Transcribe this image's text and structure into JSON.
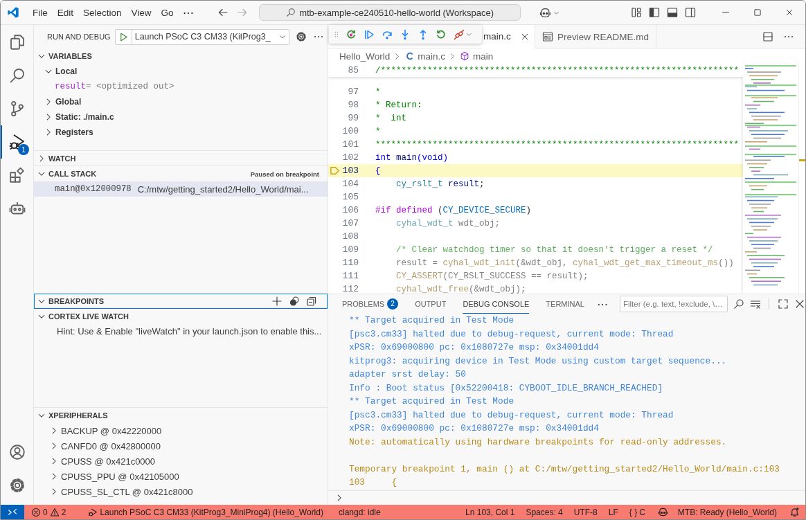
{
  "title_bar": {
    "menu": [
      {
        "label": "File"
      },
      {
        "label": "Edit"
      },
      {
        "label": "Selection"
      },
      {
        "label": "View"
      },
      {
        "label": "Go"
      }
    ],
    "overflow": "···",
    "command_center": "mtb-example-ce240510-hello-world (Workspace)"
  },
  "activity_bar": {
    "items": [
      {
        "kind": "explorer",
        "selected": false
      },
      {
        "kind": "search",
        "selected": false
      },
      {
        "kind": "source-control",
        "selected": false
      },
      {
        "kind": "run-debug",
        "selected": true,
        "badge": "1"
      },
      {
        "kind": "extensions",
        "selected": false
      },
      {
        "kind": "robot",
        "selected": false
      }
    ],
    "bottom": [
      {
        "kind": "account"
      },
      {
        "kind": "settings"
      }
    ]
  },
  "sidebar": {
    "title": "RUN AND DEBUG",
    "launch_config": "Launch PSoC C3 CM33 (KitProg3_",
    "sections": [
      {
        "kind": "variables",
        "title": "VARIABLES",
        "expanded": true,
        "items": [
          {
            "label": "Local",
            "expanded": true,
            "children": [
              {
                "name": "result",
                "value": "= <optimized out>"
              }
            ]
          },
          {
            "label": "Global",
            "expanded": false
          },
          {
            "label": "Static: ./main.c",
            "expanded": false
          },
          {
            "label": "Registers",
            "expanded": false
          }
        ]
      },
      {
        "kind": "watch",
        "title": "WATCH",
        "expanded": false
      },
      {
        "kind": "call-stack",
        "title": "CALL STACK",
        "expanded": true,
        "status": "Paused on breakpoint",
        "frames": [
          {
            "function": "main@0x12000978",
            "location": "C:/mtw/getting_started2/Hello_World/mai...",
            "selected": true
          }
        ]
      },
      {
        "kind": "breakpoints",
        "title": "BREAKPOINTS",
        "expanded": true,
        "focused": true
      },
      {
        "kind": "hint",
        "title": "CORTEX LIVE WATCH",
        "expanded": true,
        "hint": "Hint: Use & Enable \"liveWatch\" in your launch.json to enable this..."
      },
      {
        "kind": "peripherals",
        "title": "XPERIPHERALS",
        "expanded": true,
        "items": [
          {
            "label": "BACKUP @ 0x42220000",
            "expanded": false
          },
          {
            "label": "CANFD0 @ 0x42800000",
            "expanded": false
          },
          {
            "label": "CPUSS @ 0x421c0000",
            "expanded": false
          },
          {
            "label": "CPUSS_PPU @ 0x42105000",
            "expanded": false
          },
          {
            "label": "CPUSS_SL_CTL @ 0x421c8000",
            "expanded": false
          }
        ]
      }
    ]
  },
  "editor": {
    "tabs": [
      {
        "label": "main.c",
        "kind": "c",
        "selected": true
      },
      {
        "label": "Preview README.md",
        "kind": "preview",
        "selected": false
      }
    ],
    "breadcrumbs": [
      {
        "kind": "folder",
        "label": "Hello_World"
      },
      {
        "kind": "c-file",
        "label": "main.c"
      },
      {
        "kind": "symbol",
        "label": "main"
      }
    ],
    "sticky": {
      "number": "85",
      "segments": [
        {
          "kind": "comment",
          "text": "/*********************************************************************"
        }
      ]
    },
    "lines": [
      {
        "number": "97",
        "current": false,
        "segments": [
          {
            "kind": "comment",
            "text": "*"
          }
        ]
      },
      {
        "number": "98",
        "current": false,
        "segments": [
          {
            "kind": "comment",
            "text": "* Return:"
          }
        ]
      },
      {
        "number": "99",
        "current": false,
        "segments": [
          {
            "kind": "comment",
            "text": "*  int"
          }
        ]
      },
      {
        "number": "100",
        "current": false,
        "segments": [
          {
            "kind": "comment",
            "text": "*"
          }
        ]
      },
      {
        "number": "101",
        "current": false,
        "segments": [
          {
            "kind": "comment",
            "text": "**********************************************************************"
          }
        ]
      },
      {
        "number": "102",
        "current": false,
        "segments": [
          {
            "kind": "keyword",
            "text": "int"
          },
          {
            "kind": "func",
            "text": " main"
          },
          {
            "kind": "keyword",
            "text": "(void)"
          }
        ]
      },
      {
        "number": "103",
        "current": true,
        "segments": [
          {
            "kind": "keyword",
            "text": "{"
          }
        ]
      },
      {
        "number": "104",
        "current": false,
        "segments": [
          {
            "kind": "type",
            "text": "    cy_rslt_t"
          },
          {
            "kind": "variable",
            "text": " result"
          },
          {
            "kind": "plain",
            "text": ";"
          }
        ]
      },
      {
        "number": "105",
        "current": false
      },
      {
        "number": "106",
        "current": false,
        "segments": [
          {
            "kind": "preproc",
            "text": "#if defined"
          },
          {
            "kind": "plain",
            "text": " ("
          },
          {
            "kind": "macro",
            "text": "CY_DEVICE_SECURE"
          },
          {
            "kind": "plain",
            "text": ")"
          }
        ]
      },
      {
        "number": "107",
        "current": false,
        "segments": [
          {
            "kind": "dimtype",
            "text": "    cyhal_wdt_t"
          },
          {
            "kind": "dim",
            "text": " wdt_obj;"
          }
        ]
      },
      {
        "number": "108",
        "current": false
      },
      {
        "number": "109",
        "current": false,
        "segments": [
          {
            "kind": "dimcomment",
            "text": "    /* Clear watchdog timer so that it doesn't trigger a reset */"
          }
        ]
      },
      {
        "number": "110",
        "current": false,
        "segments": [
          {
            "kind": "dim",
            "text": "    result = "
          },
          {
            "kind": "dimfunc",
            "text": "cyhal_wdt_init"
          },
          {
            "kind": "dim",
            "text": "(&wdt_obj, "
          },
          {
            "kind": "dimfunc",
            "text": "cyhal_wdt_get_max_timeout_ms"
          },
          {
            "kind": "dim",
            "text": "())"
          }
        ]
      },
      {
        "number": "111",
        "current": false,
        "segments": [
          {
            "kind": "dimfunc",
            "text": "    CY_ASSERT"
          },
          {
            "kind": "dim",
            "text": "(CY_RSLT_SUCCESS == result);"
          }
        ]
      },
      {
        "number": "112",
        "current": false,
        "segments": [
          {
            "kind": "dimfunc",
            "text": "    cyhal_wdt_free"
          },
          {
            "kind": "dim",
            "text": "(&wdt_obj);"
          }
        ]
      }
    ]
  },
  "panel": {
    "tabs": [
      {
        "label": "PROBLEMS",
        "badge": "2",
        "selected": false
      },
      {
        "label": "OUTPUT",
        "selected": false
      },
      {
        "label": "DEBUG CONSOLE",
        "selected": true
      },
      {
        "label": "TERMINAL",
        "selected": false
      }
    ],
    "overflow": "···",
    "filter_placeholder": "Filter (e.g. text, !exclude, \\…",
    "console": [
      {
        "kind": "info",
        "text": "** Target acquired in Test Mode"
      },
      {
        "kind": "info",
        "text": "[psc3.cm33] halted due to debug-request, current mode: Thread"
      },
      {
        "kind": "info",
        "text": "xPSR: 0x69000800 pc: 0x1080727e msp: 0x34001dd4"
      },
      {
        "kind": "info",
        "text": "kitprog3: acquiring device in Test Mode using custom target sequence..."
      },
      {
        "kind": "info",
        "text": "adapter srst delay: 50"
      },
      {
        "kind": "info",
        "text": "Info : Boot status [0x52200418: CYBOOT_IDLE_BRANCH_REACHED]"
      },
      {
        "kind": "info",
        "text": "** Target acquired in Test Mode"
      },
      {
        "kind": "info",
        "text": "[psc3.cm33] halted due to debug-request, current mode: Thread"
      },
      {
        "kind": "info",
        "text": "xPSR: 0x69000800 pc: 0x1080727e msp: 0x34001dd4"
      },
      {
        "kind": "warning",
        "text": "Note: automatically using hardware breakpoints for read-only addresses."
      },
      {
        "kind": "blank"
      },
      {
        "kind": "warning",
        "text": "Temporary breakpoint 1, main () at C:/mtw/getting_started2/Hello_World/main.c:103"
      },
      {
        "kind": "warning",
        "text": "103     {"
      }
    ]
  },
  "status_bar": {
    "debugging": true,
    "left": [
      {
        "kind": "remote"
      },
      {
        "kind": "problems",
        "errors": "0",
        "warnings": "2"
      },
      {
        "kind": "launch",
        "text": "Launch PSoC C3 CM33 (KitProg3_MiniProg4) (Hello_World)"
      },
      {
        "kind": "text",
        "text": "clangd: idle"
      }
    ],
    "right": [
      {
        "kind": "text",
        "text": "Ln 103, Col 1"
      },
      {
        "kind": "text",
        "text": "Spaces: 4"
      },
      {
        "kind": "text",
        "text": "UTF-8"
      },
      {
        "kind": "text",
        "text": "LF"
      },
      {
        "kind": "language",
        "icon_text": "{ }",
        "text": "C"
      },
      {
        "kind": "copilot"
      },
      {
        "kind": "text",
        "text": "MTB: Ready (Hello_World)"
      },
      {
        "kind": "notifications"
      }
    ]
  }
}
